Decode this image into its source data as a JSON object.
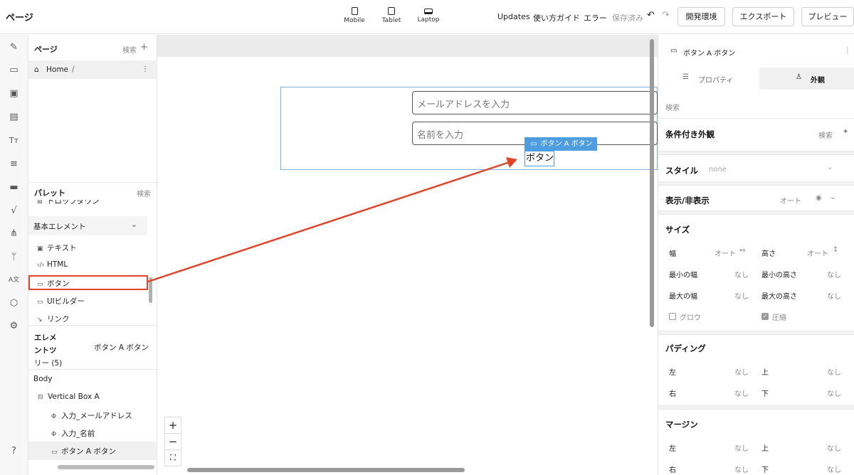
{
  "app": {
    "title": "ページ"
  },
  "devices": [
    {
      "label": "Mobile",
      "icon": "mobile-icon"
    },
    {
      "label": "Tablet",
      "icon": "tablet-icon"
    },
    {
      "label": "Laptop",
      "icon": "laptop-icon"
    }
  ],
  "topbar": {
    "updates": "Updates",
    "guide": "使い方ガイド",
    "errors": "エラー",
    "saved": "保存済み",
    "env_button": "開発環境",
    "export_button": "エクスポート",
    "preview_button": "プレビュー"
  },
  "pages_panel": {
    "title": "ページ",
    "search": "検索",
    "add": "+",
    "home_item": "Home",
    "home_path": "/",
    "more": "⋮"
  },
  "palette": {
    "title": "パレット",
    "search": "検索",
    "partial_item": "ドロップダウン",
    "group_title": "基本エレメント",
    "items": [
      {
        "label": "テキスト"
      },
      {
        "label": "HTML"
      },
      {
        "label": "ボタン"
      },
      {
        "label": "UIビルダー"
      },
      {
        "label": "リンク"
      }
    ]
  },
  "element_tree": {
    "title_line1": "エレメ",
    "title_line2": "ントツ",
    "title_line3": "リー (5)",
    "selected": "ボタン A ボタン",
    "items": [
      {
        "label": "Body"
      },
      {
        "label": "Vertical Box A"
      },
      {
        "label": "入力_メールアドレス"
      },
      {
        "label": "入力_名前"
      },
      {
        "label": "ボタン A ボタン"
      }
    ]
  },
  "canvas": {
    "email_placeholder": "メールアドレスを入力",
    "name_placeholder": "名前を入力",
    "selection_tag": "ボタン A ボタン",
    "button_text": "ボタン",
    "zoom_in": "+",
    "zoom_out": "−",
    "fit": "⛶"
  },
  "inspector": {
    "element_name": "ボタン A ボタン",
    "more": "⋮",
    "tab_properties": "プロパティ",
    "tab_appearance": "外観",
    "search": "検索",
    "conditional_title": "条件付き外観",
    "conditional_search": "検索",
    "style_title": "スタイル",
    "style_value": "none",
    "visibility_title": "表示/非表示",
    "visibility_value": "オート",
    "size_title": "サイズ",
    "width_label": "幅",
    "width_value": "オート",
    "height_label": "高さ",
    "height_value": "オート",
    "min_width_label": "最小の幅",
    "min_width_value": "なし",
    "min_height_label": "最小の高さ",
    "min_height_value": "なし",
    "max_width_label": "最大の幅",
    "max_width_value": "なし",
    "max_height_label": "最大の高さ",
    "max_height_value": "なし",
    "grow_label": "グロウ",
    "shrink_label": "圧縮",
    "padding_title": "パディング",
    "padding_left_label": "左",
    "padding_left_value": "なし",
    "padding_top_label": "上",
    "padding_top_value": "なし",
    "padding_right_label": "右",
    "padding_right_value": "なし",
    "padding_bottom_label": "下",
    "padding_bottom_value": "なし",
    "margin_title": "マージン",
    "margin_left_label": "左",
    "margin_left_value": "なし",
    "margin_top_label": "上",
    "margin_top_value": "なし",
    "margin_right_label": "右",
    "margin_right_value": "なし",
    "margin_bottom_label": "下",
    "margin_bottom_value": "なし"
  },
  "colors": {
    "accent": "#4d9de0",
    "annotation": "#e0452a",
    "selection_row": "#f0f0f0"
  }
}
